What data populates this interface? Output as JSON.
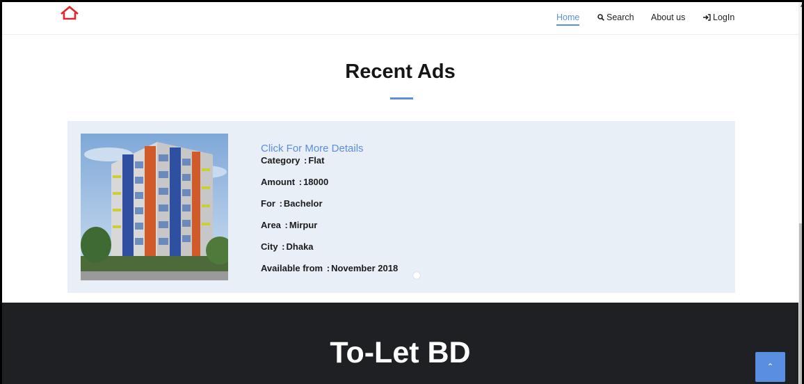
{
  "nav": {
    "home": "Home",
    "search": "Search",
    "about": "About us",
    "login": "LogIn"
  },
  "page": {
    "heading": "Recent Ads"
  },
  "ad": {
    "link": "Click For More Details",
    "fields": [
      {
        "label": "Category",
        "value": "Flat"
      },
      {
        "label": "Amount",
        "value": "18000"
      },
      {
        "label": "For",
        "value": "Bachelor"
      },
      {
        "label": "Area",
        "value": "Mirpur"
      },
      {
        "label": "City",
        "value": "Dhaka"
      },
      {
        "label": "Available from",
        "value": "November 2018"
      }
    ]
  },
  "footer": {
    "title": "To-Let BD"
  },
  "icons": {
    "logo": "house-outline-icon",
    "search": "magnifier-icon",
    "login": "sign-in-icon",
    "scroll_top": "chevron-up-icon"
  },
  "colors": {
    "accent": "#5a8ee0",
    "logo": "#e0262a",
    "card": "#e8eff7",
    "footer": "#1f2023"
  }
}
